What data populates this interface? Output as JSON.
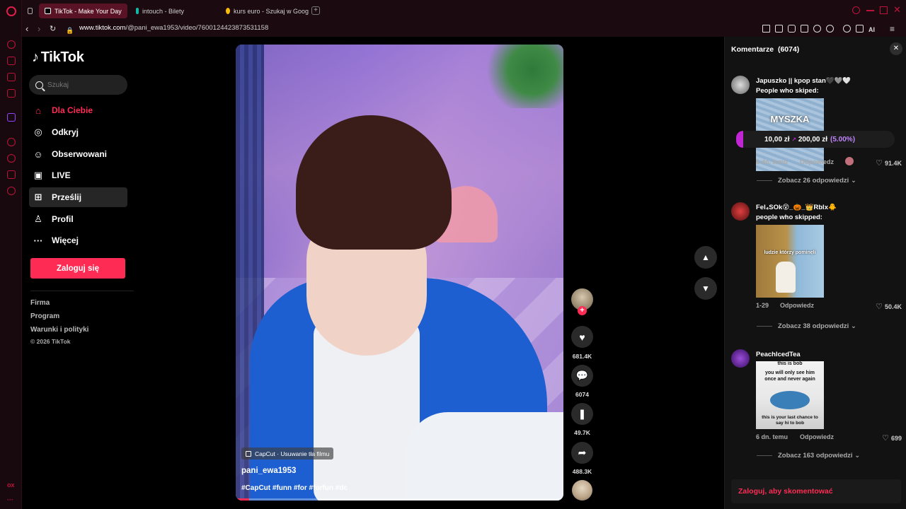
{
  "browser": {
    "tabs": [
      {
        "label": "TikTok - Make Your Day",
        "active": true
      },
      {
        "label": "intouch - Bilety",
        "active": false
      },
      {
        "label": "kurs euro - Szukaj w Goog",
        "active": false
      }
    ],
    "url_host": "www.tiktok.com",
    "url_path": "/@pani_ewa1953/video/7600124423873531158",
    "ai_label": "AI",
    "sidebar_bottom": "ox"
  },
  "nav": {
    "logo": "TikTok",
    "search_placeholder": "Szukaj",
    "items": [
      {
        "label": "Dla Ciebie",
        "icon": "home-icon"
      },
      {
        "label": "Odkryj",
        "icon": "compass-icon"
      },
      {
        "label": "Obserwowani",
        "icon": "user-follow-icon"
      },
      {
        "label": "LIVE",
        "icon": "tv-icon"
      },
      {
        "label": "Prześlij",
        "icon": "upload-icon"
      },
      {
        "label": "Profil",
        "icon": "person-icon"
      },
      {
        "label": "Więcej",
        "icon": "more-icon"
      }
    ],
    "login_button": "Zaloguj się",
    "footer_links": [
      "Firma",
      "Program",
      "Warunki i polityki"
    ],
    "copyright": "© 2026 TikTok"
  },
  "video": {
    "capcut_label": "CapCut · Usuwanie tła filmu",
    "author": "pani_ewa1953",
    "hashtags": "#CapCut #funn #for #forfun #dc",
    "progress": 0.04
  },
  "actions": {
    "likes": "681.4K",
    "comments": "6074",
    "saves": "49.7K",
    "shares": "488.3K"
  },
  "comments": {
    "title": "Komentarze",
    "count": "(6074)",
    "login_prompt": "Zaloguj, aby skomentować",
    "items": [
      {
        "user": "Japuszko || kpop stan🖤🩶🤍",
        "text": "People who skiped:",
        "image_caption": "MYSZKA",
        "price_from": "10,00 zł",
        "price_to": "200,00 zł",
        "price_pct": "(5.00%)",
        "time": "6 dn. temu",
        "reply": "Odpowiedz",
        "likes": "91.4K",
        "more": "Zobacz 26 odpowiedzi"
      },
      {
        "user": "Fel₄SOk😵_🎃_👑Rblx🐥",
        "text": "people who skipped:",
        "image_caption": "ludzie którzy pominęli",
        "time": "1-29",
        "reply": "Odpowiedz",
        "likes": "50.4K",
        "more": "Zobacz 38 odpowiedzi"
      },
      {
        "user": "PeachIcedTea",
        "image_top_text": "this is bob",
        "image_mid_text": "you will only see him once and never again",
        "image_bottom_text": "this is your last chance to say hi to bob",
        "time": "6 dn. temu",
        "reply": "Odpowiedz",
        "likes": "699",
        "more": "Zobacz 163 odpowiedzi"
      }
    ]
  }
}
